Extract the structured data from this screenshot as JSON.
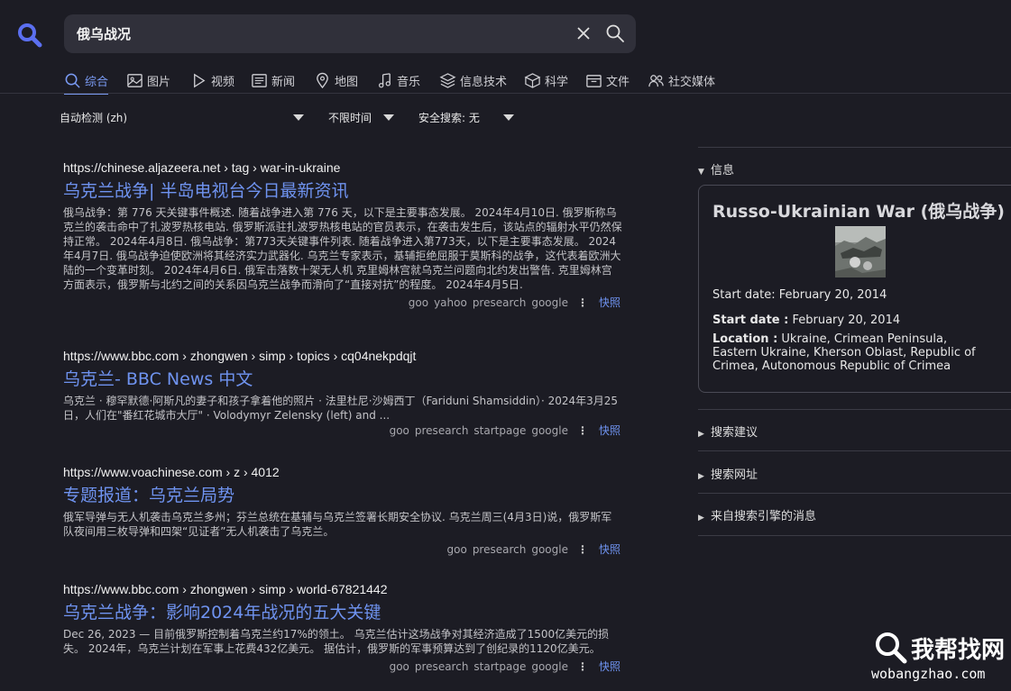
{
  "search": {
    "query": "俄乌战况"
  },
  "tabs": [
    {
      "label": "综合",
      "icon": "search-icon"
    },
    {
      "label": "图片",
      "icon": "image-icon"
    },
    {
      "label": "视频",
      "icon": "play-icon"
    },
    {
      "label": "新闻",
      "icon": "newspaper-icon"
    },
    {
      "label": "地图",
      "icon": "map-pin-icon"
    },
    {
      "label": "音乐",
      "icon": "music-note-icon"
    },
    {
      "label": "信息技术",
      "icon": "layers-icon"
    },
    {
      "label": "科学",
      "icon": "cube-icon"
    },
    {
      "label": "文件",
      "icon": "file-box-icon"
    },
    {
      "label": "社交媒体",
      "icon": "users-icon"
    }
  ],
  "filters": {
    "language": "自动检测 (zh)",
    "time": "不限时间",
    "safesearch": "安全搜索: 无"
  },
  "results": [
    {
      "url": "https://chinese.aljazeera.net",
      "path": "› tag › war-in-ukraine",
      "title": "乌克兰战争| 半岛电视台今日最新资讯",
      "snippet": "俄乌战争：第 776 天关键事件概述. 随着战争进入第 776 天，以下是主要事态发展。 2024年4月10日. 俄罗斯称乌克兰的袭击命中了扎波罗热核电站. 俄罗斯派驻扎波罗热核电站的官员表示，在袭击发生后，该站点的辐射水平仍然保持正常。 2024年4月8日. 俄乌战争：第773天关键事件列表. 随着战争进入第773天，以下是主要事态发展。 2024年4月7日. 俄乌战争迫使欧洲将其经济实力武器化. 乌克兰专家表示，基辅拒绝屈服于莫斯科的战争，这代表着欧洲大陆的一个变革时刻。 2024年4月6日. 俄军击落数十架无人机 克里姆林宫就乌克兰问题向北约发出警告. 克里姆林宫方面表示，俄罗斯与北约之间的关系因乌克兰战争而滑向了“直接对抗”的程度。 2024年4月5日.",
      "engines": [
        "goo",
        "yahoo",
        "presearch",
        "google"
      ],
      "cache": "快照"
    },
    {
      "url": "https://www.bbc.com",
      "path": "› zhongwen › simp › topics › cq04nekpdqjt",
      "title": "乌克兰- BBC News 中文",
      "snippet": "乌克兰 · 穆罕默德·阿斯凡的妻子和孩子拿着他的照片 · 法里杜尼·沙姆西丁（Fariduni Shamsiddin）· 2024年3月25日，人们在\"番红花城市大厅\" · Volodymyr Zelensky (left) and ...",
      "engines": [
        "goo",
        "presearch",
        "startpage",
        "google"
      ],
      "cache": "快照"
    },
    {
      "url": "https://www.voachinese.com",
      "path": "› z › 4012",
      "title": "专题报道：乌克兰局势",
      "snippet": "俄军导弹与无人机袭击乌克兰多州；芬兰总统在基辅与乌克兰签署长期安全协议. 乌克兰周三(4月3日)说，俄罗斯军队夜间用三枚导弹和四架“见证者”无人机袭击了乌克兰。",
      "engines": [
        "goo",
        "presearch",
        "google"
      ],
      "cache": "快照"
    },
    {
      "url": "https://www.bbc.com",
      "path": "› zhongwen › simp › world-67821442",
      "title": "乌克兰战争：影响2024年战况的五大关键",
      "snippet": "Dec 26, 2023 — 目前俄罗斯控制着乌克兰约17%的领土。 乌克兰估计这场战争对其经济造成了1500亿美元的损失。 2024年，乌克兰计划在军事上花费432亿美元。 据估计，俄罗斯的军事预算达到了创纪录的1120亿美元。",
      "engines": [
        "goo",
        "presearch",
        "startpage",
        "google"
      ],
      "cache": "快照"
    }
  ],
  "sidebar": {
    "info_label": "信息",
    "infobox": {
      "title": "Russo-Ukrainian War (俄乌战争)",
      "start_line": "Start date: February 20, 2014",
      "start_label": "Start date :",
      "start_value": "February 20, 2014",
      "location_label": "Location :",
      "location_value": "Ukraine, Crimean Peninsula, Eastern Ukraine, Kherson Oblast, Republic of Crimea, Autonomous Republic of Crimea"
    },
    "suggestions_label": "搜索建议",
    "urls_label": "搜索网址",
    "engine_messages_label": "来自搜索引擎的消息"
  },
  "watermark": {
    "brand": "我帮找网",
    "domain": "wobangzhao.com"
  },
  "colors": {
    "background": "#1c1c24",
    "accent": "#6f93f0",
    "search_box": "#30303a"
  }
}
